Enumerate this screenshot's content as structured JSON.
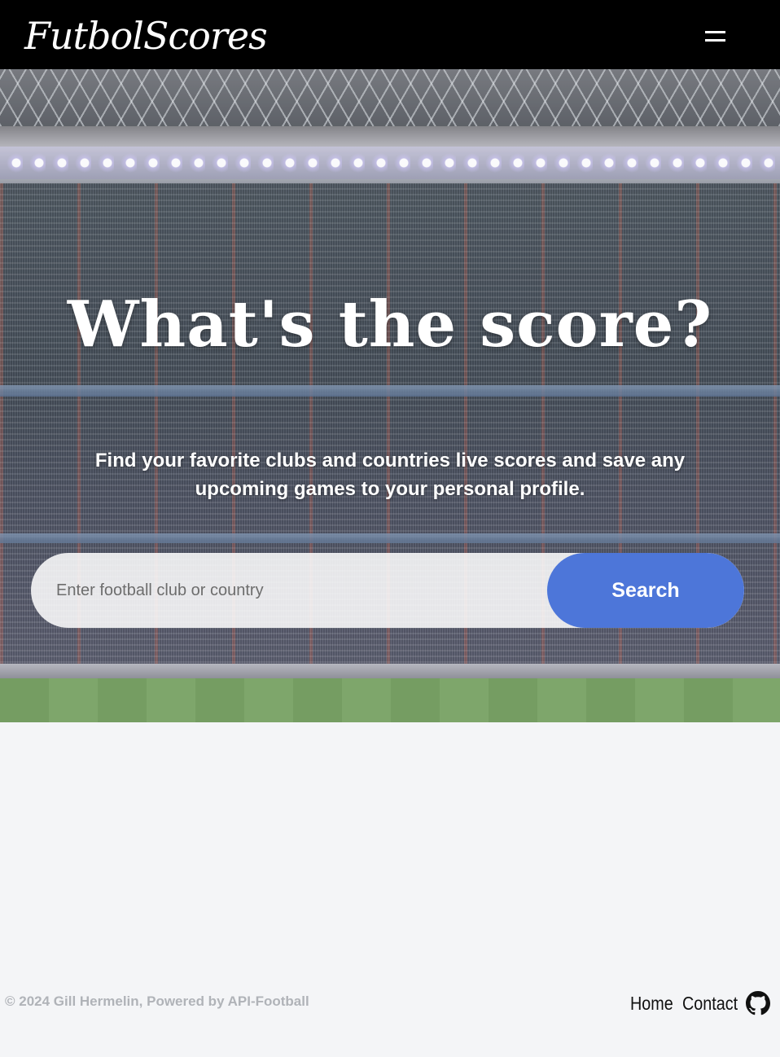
{
  "navbar": {
    "brand": "FutbolScores",
    "menu_icon": "hamburger-menu-icon"
  },
  "hero": {
    "title": "What's the score?",
    "subtitle": "Find your favorite clubs and countries live scores and save any upcoming games to your personal profile.",
    "background": "stadium-photo",
    "search": {
      "placeholder": "Enter football club or country",
      "value": "",
      "button_label": "Search",
      "button_color": "#4d76d9"
    }
  },
  "footer": {
    "copyright": "© 2024 Gill Hermelin, Powered by API-Football",
    "links": [
      {
        "label": "Home"
      },
      {
        "label": "Contact"
      }
    ],
    "github_icon": "github-icon"
  }
}
